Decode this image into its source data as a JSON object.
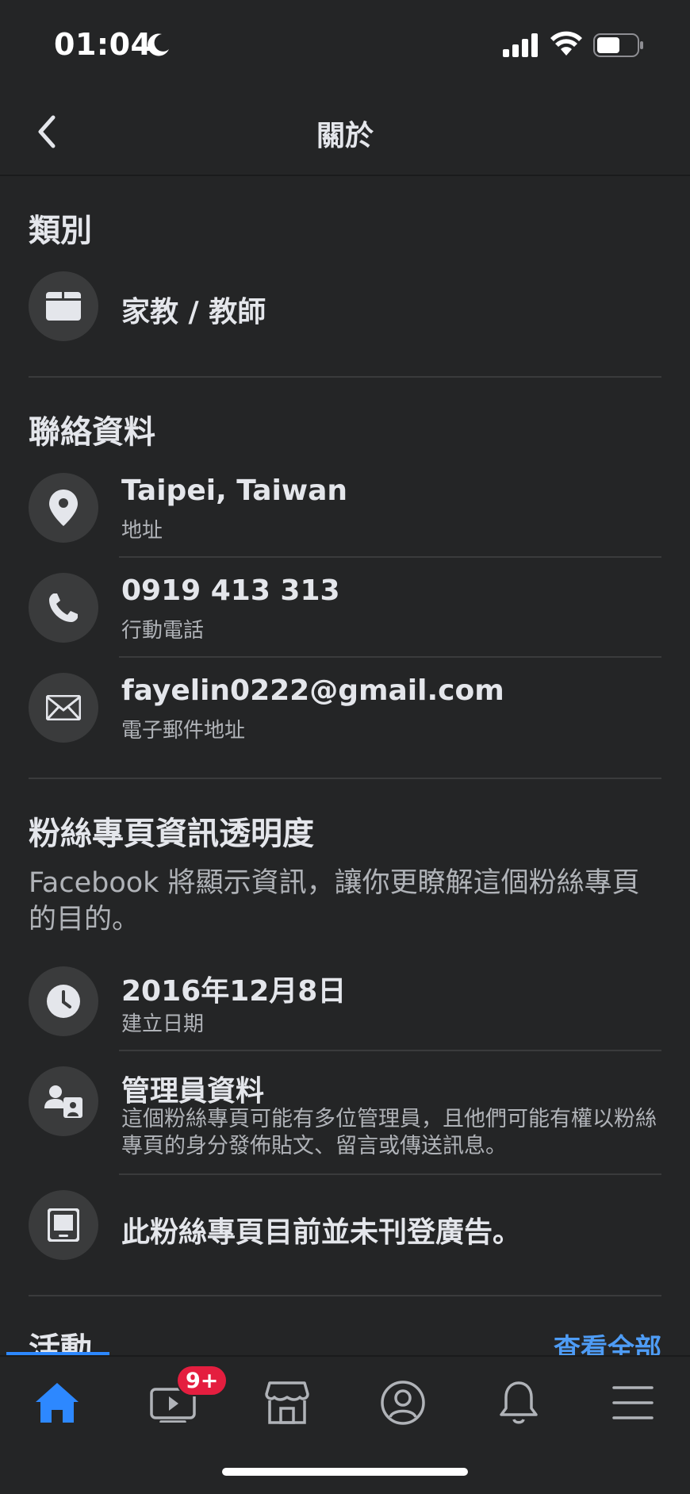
{
  "status_bar": {
    "time": "01:04"
  },
  "header": {
    "title": "關於"
  },
  "category": {
    "title": "類別",
    "value": "家教 / 教師"
  },
  "contact": {
    "title": "聯絡資料",
    "items": [
      {
        "icon": "location-pin-icon",
        "primary": "Taipei, Taiwan",
        "secondary": "地址"
      },
      {
        "icon": "phone-icon",
        "primary": "0919 413 313",
        "secondary": "行動電話"
      },
      {
        "icon": "mail-icon",
        "primary": "fayelin0222@gmail.com",
        "secondary": "電子郵件地址"
      }
    ]
  },
  "transparency": {
    "title": "粉絲專頁資訊透明度",
    "description": "Facebook 將顯示資訊，讓你更瞭解這個粉絲專頁的目的。",
    "items": [
      {
        "icon": "clock-icon",
        "primary": "2016年12月8日",
        "secondary": "建立日期"
      },
      {
        "icon": "admins-icon",
        "primary": "管理員資料",
        "secondary": "這個粉絲專頁可能有多位管理員，且他們可能有權以粉絲專頁的身分發佈貼文、留言或傳送訊息。"
      },
      {
        "icon": "ads-device-icon",
        "primary": "此粉絲專頁目前並未刊登廣告。"
      }
    ]
  },
  "activity": {
    "title": "活動",
    "see_all": "查看全部"
  },
  "tab_bar": {
    "active": "home",
    "tabs": [
      "home",
      "watch",
      "marketplace",
      "profile",
      "notifications",
      "menu"
    ],
    "watch_badge": "9+"
  },
  "colors": {
    "background": "#242526",
    "accent": "#2d88ff",
    "link": "#4e9cf5",
    "badge": "#e41e3f"
  }
}
